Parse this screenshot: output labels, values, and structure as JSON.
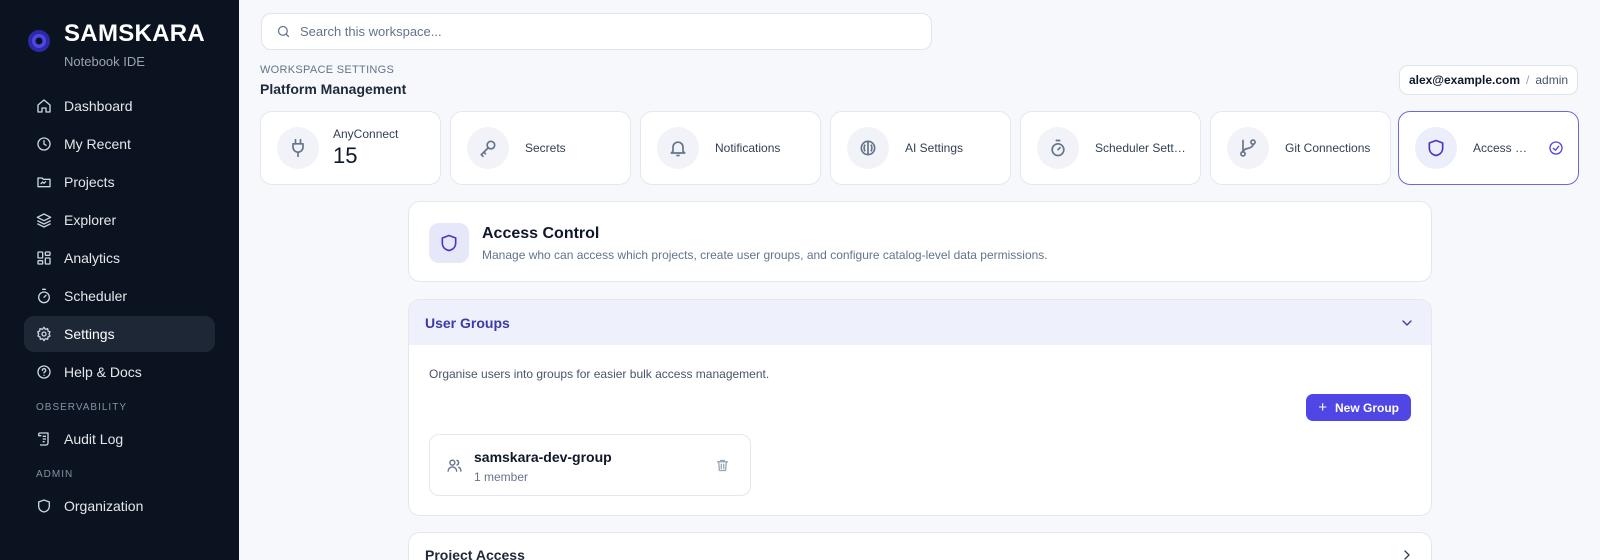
{
  "brand": {
    "title": "SAMSKARA",
    "subtitle": "Notebook IDE",
    "logo_color": "#4f46e5"
  },
  "nav": {
    "items": [
      {
        "label": "Dashboard",
        "icon": "home-icon"
      },
      {
        "label": "My Recent",
        "icon": "clock-icon"
      },
      {
        "label": "Projects",
        "icon": "folder-icon"
      },
      {
        "label": "Explorer",
        "icon": "layers-icon"
      },
      {
        "label": "Analytics",
        "icon": "grid-icon"
      },
      {
        "label": "Scheduler",
        "icon": "timer-icon"
      },
      {
        "label": "Settings",
        "icon": "gear-icon",
        "active": true
      },
      {
        "label": "Help & Docs",
        "icon": "help-icon"
      }
    ],
    "observability_label": "OBSERVABILITY",
    "observability_items": [
      {
        "label": "Audit Log",
        "icon": "scroll-icon"
      }
    ],
    "admin_label": "ADMIN",
    "admin_items": [
      {
        "label": "Organization",
        "icon": "shield-icon"
      }
    ]
  },
  "search": {
    "placeholder": "Search this workspace..."
  },
  "header": {
    "eyebrow": "WORKSPACE SETTINGS",
    "title": "Platform Management"
  },
  "user": {
    "email": "alex@example.com",
    "separator": "/",
    "role": "admin"
  },
  "settings_cards": [
    {
      "label": "AnyConnect",
      "value": "15",
      "icon": "plug-icon"
    },
    {
      "label": "Secrets",
      "icon": "key-icon"
    },
    {
      "label": "Notifications",
      "icon": "bell-icon"
    },
    {
      "label": "AI Settings",
      "icon": "brain-icon"
    },
    {
      "label": "Scheduler Settings",
      "icon": "timer-icon"
    },
    {
      "label": "Git Connections",
      "icon": "git-branch-icon"
    },
    {
      "label": "Access Control",
      "icon": "shield-icon",
      "active": true
    }
  ],
  "access_control": {
    "title": "Access Control",
    "description": "Manage who can access which projects, create user groups, and configure catalog-level data permissions."
  },
  "user_groups": {
    "title": "User Groups",
    "description": "Organise users into groups for easier bulk access management.",
    "new_button": "New Group",
    "groups": [
      {
        "name": "samskara-dev-group",
        "members": "1 member"
      }
    ]
  },
  "project_access": {
    "title": "Project Access"
  },
  "colors": {
    "accent": "#4f46e5",
    "sidebar_bg": "#0b1220",
    "panel_header_bg": "#eef0fb"
  }
}
